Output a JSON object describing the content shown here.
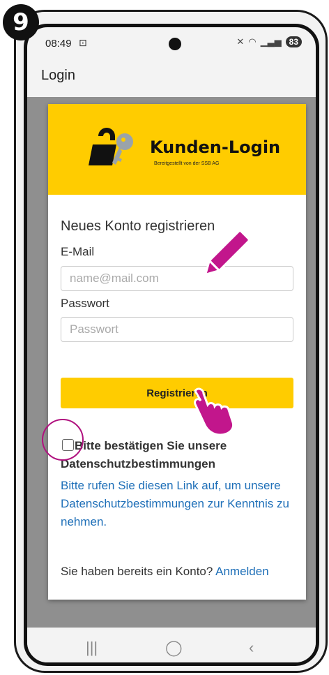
{
  "step_badge": "9",
  "status": {
    "time": "08:49",
    "battery": "83"
  },
  "app": {
    "title": "Login"
  },
  "logo": {
    "title": "Kunden-Login",
    "subtitle": "Bereitgestellt von der SSB AG"
  },
  "form": {
    "heading": "Neues Konto registrieren",
    "email_label": "E-Mail",
    "email_placeholder": "name@mail.com",
    "password_label": "Passwort",
    "password_placeholder": "Passwort",
    "submit_label": "Registrieren",
    "privacy_checkbox_label": "Bitte bestätigen Sie unsere Datenschutzbestimmungen",
    "privacy_link_text": "Bitte rufen Sie diesen Link auf, um unsere Datenschutzbestimmungen zur Kenntnis zu nehmen.",
    "login_prompt": "Sie haben bereits ein Konto?",
    "login_link": "Anmelden"
  },
  "colors": {
    "brand_yellow": "#ffcc00",
    "link_blue": "#1e6fb8",
    "annotation_magenta": "#b0127f"
  },
  "icons": {
    "nav_recent": "recent-apps-icon",
    "nav_home": "home-icon",
    "nav_back": "back-icon"
  }
}
